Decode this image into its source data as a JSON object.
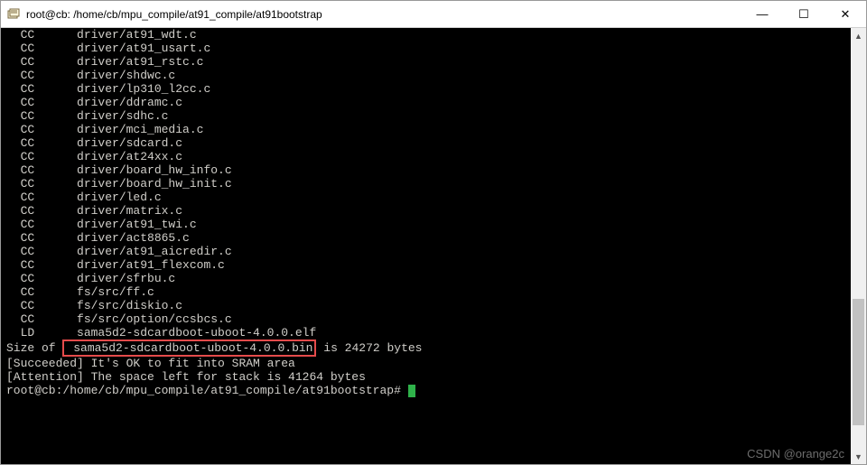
{
  "window": {
    "title": "root@cb: /home/cb/mpu_compile/at91_compile/at91bootstrap"
  },
  "controls": {
    "min": "—",
    "max": "☐",
    "close": "✕"
  },
  "lines": [
    {
      "col1": "  CC",
      "col2": "driver/at91_wdt.c"
    },
    {
      "col1": "  CC",
      "col2": "driver/at91_usart.c"
    },
    {
      "col1": "  CC",
      "col2": "driver/at91_rstc.c"
    },
    {
      "col1": "  CC",
      "col2": "driver/shdwc.c"
    },
    {
      "col1": "  CC",
      "col2": "driver/lp310_l2cc.c"
    },
    {
      "col1": "  CC",
      "col2": "driver/ddramc.c"
    },
    {
      "col1": "  CC",
      "col2": "driver/sdhc.c"
    },
    {
      "col1": "  CC",
      "col2": "driver/mci_media.c"
    },
    {
      "col1": "  CC",
      "col2": "driver/sdcard.c"
    },
    {
      "col1": "  CC",
      "col2": "driver/at24xx.c"
    },
    {
      "col1": "  CC",
      "col2": "driver/board_hw_info.c"
    },
    {
      "col1": "  CC",
      "col2": "driver/board_hw_init.c"
    },
    {
      "col1": "  CC",
      "col2": "driver/led.c"
    },
    {
      "col1": "  CC",
      "col2": "driver/matrix.c"
    },
    {
      "col1": "  CC",
      "col2": "driver/at91_twi.c"
    },
    {
      "col1": "  CC",
      "col2": "driver/act8865.c"
    },
    {
      "col1": "  CC",
      "col2": "driver/at91_aicredir.c"
    },
    {
      "col1": "  CC",
      "col2": "driver/at91_flexcom.c"
    },
    {
      "col1": "  CC",
      "col2": "driver/sfrbu.c"
    },
    {
      "col1": "  CC",
      "col2": "fs/src/ff.c"
    },
    {
      "col1": "  CC",
      "col2": "fs/src/diskio.c"
    },
    {
      "col1": "  CC",
      "col2": "fs/src/option/ccsbcs.c"
    },
    {
      "col1": "  LD",
      "col2": "sama5d2-sdcardboot-uboot-4.0.0.elf"
    }
  ],
  "size_line": {
    "prefix": "Size of ",
    "file": "sama5d2-sdcardboot-uboot-4.0.0.bin",
    "suffix": " is 24272 bytes"
  },
  "status1": "[Succeeded] It's OK to fit into SRAM area",
  "status2": "[Attention] The space left for stack is 41264 bytes",
  "prompt": "root@cb:/home/cb/mpu_compile/at91_compile/at91bootstrap# ",
  "watermark": "CSDN @orange2c",
  "scroll": {
    "up": "▲",
    "down": "▼"
  }
}
